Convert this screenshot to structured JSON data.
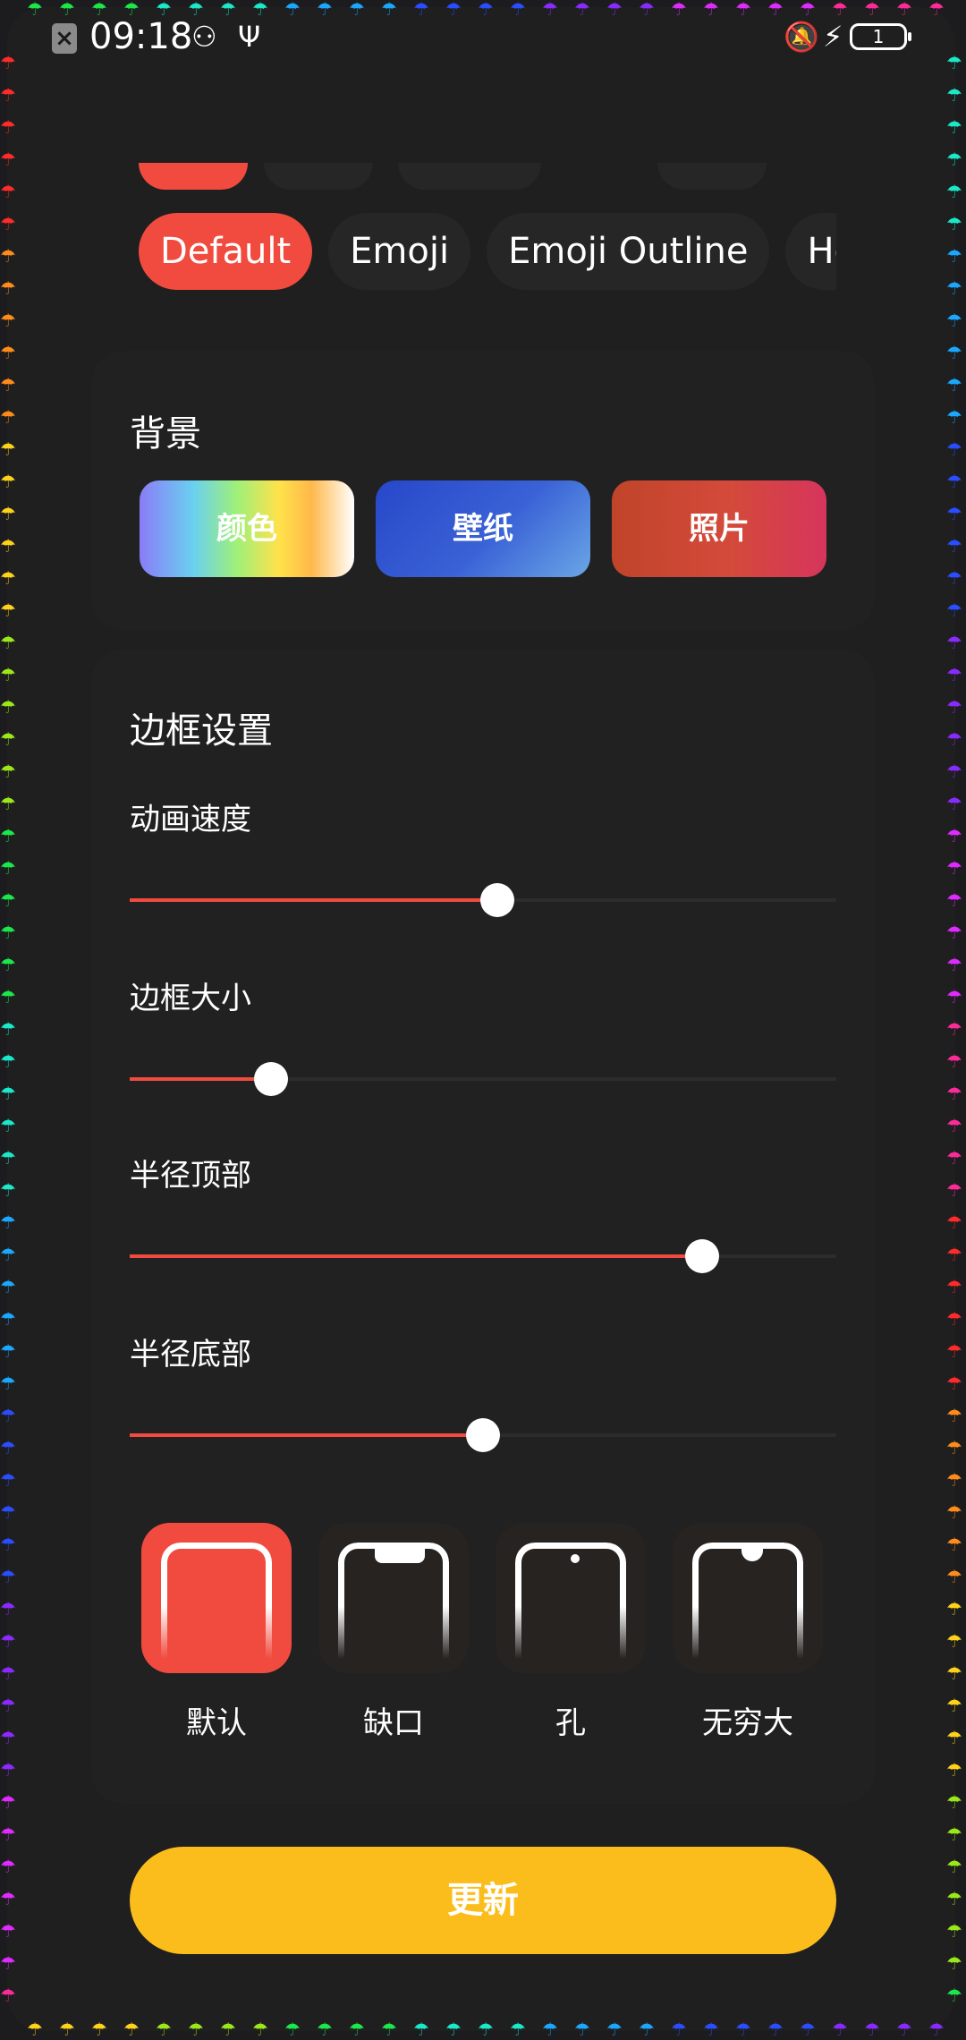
{
  "status_bar": {
    "time": "09:18",
    "battery": "1"
  },
  "themes": {
    "chips": [
      "Default",
      "Emoji",
      "Emoji Outline",
      "Ho"
    ],
    "selected": "Default"
  },
  "background": {
    "title": "背景",
    "buttons": [
      "颜色",
      "壁纸",
      "照片"
    ]
  },
  "border_settings": {
    "title": "边框设置",
    "sliders": [
      {
        "label": "动画速度",
        "value": 0.52
      },
      {
        "label": "边框大小",
        "value": 0.2
      },
      {
        "label": "半径顶部",
        "value": 0.81
      },
      {
        "label": "半径底部",
        "value": 0.5
      }
    ]
  },
  "shapes": {
    "options": [
      "默认",
      "缺口",
      "孔",
      "无穷大"
    ],
    "selected": "默认"
  },
  "update_button": "更新",
  "colors": {
    "accent": "#f14b3f",
    "update": "#fbbd1b",
    "background": "#1f1f20"
  }
}
